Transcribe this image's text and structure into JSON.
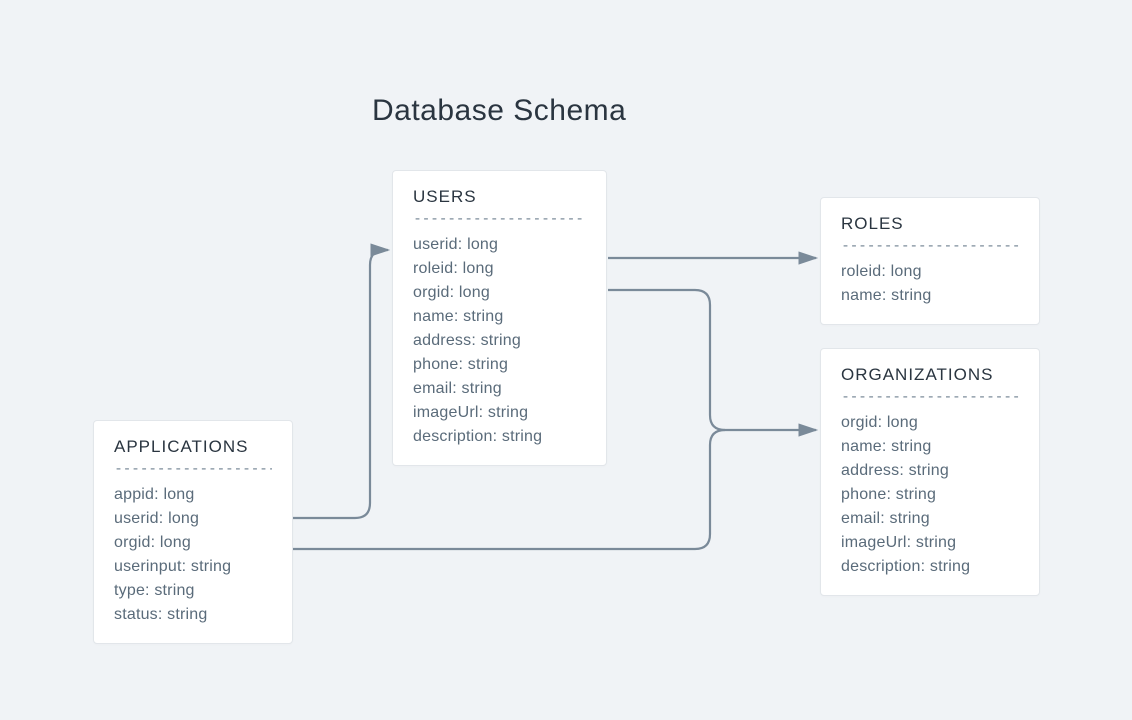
{
  "title": "Database Schema",
  "divider": "------------------------",
  "entities": {
    "applications": {
      "name": "APPLICATIONS",
      "fields": [
        "appid: long",
        "userid: long",
        "orgid: long",
        "userinput: string",
        "type: string",
        "status: string"
      ]
    },
    "users": {
      "name": "USERS",
      "fields": [
        "userid: long",
        "roleid: long",
        "orgid: long",
        "name: string",
        "address: string",
        "phone: string",
        "email: string",
        "imageUrl: string",
        "description: string"
      ]
    },
    "roles": {
      "name": "ROLES",
      "fields": [
        "roleid: long",
        "name: string"
      ]
    },
    "organizations": {
      "name": "ORGANIZATIONS",
      "fields": [
        "orgid: long",
        "name: string",
        "address: string",
        "phone: string",
        "email: string",
        "imageUrl: string",
        "description: string"
      ]
    }
  },
  "colors": {
    "connector": "#7a8a99",
    "text_primary": "#2a3540",
    "text_secondary": "#5a6b7a",
    "bg": "#f0f3f6",
    "box_bg": "#ffffff",
    "box_border": "#e2e6ea"
  }
}
